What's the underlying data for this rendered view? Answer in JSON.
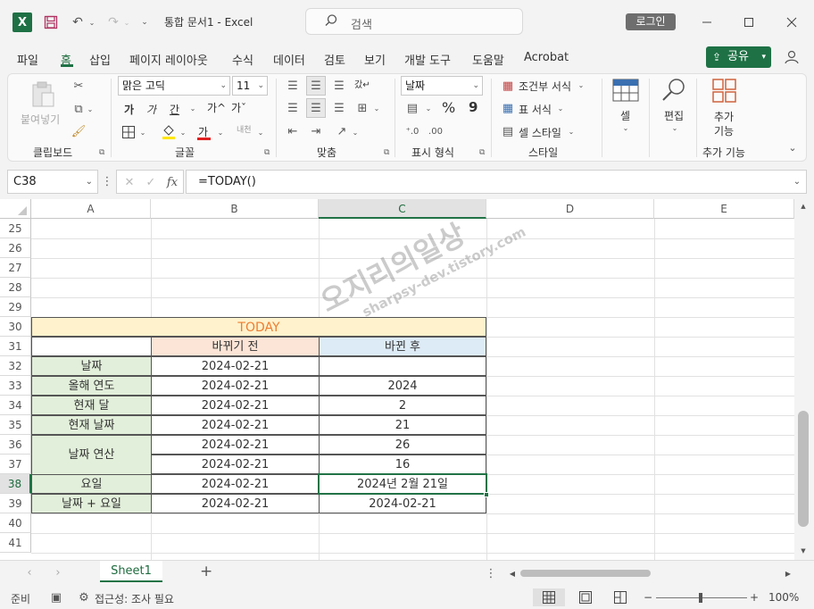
{
  "titlebar": {
    "app_title": "통합 문서1  -  Excel",
    "search_placeholder": "검색",
    "login_label": "로그인"
  },
  "menu": {
    "tabs": [
      "파일",
      "홈",
      "삽입",
      "페이지 레이아웃",
      "수식",
      "데이터",
      "검토",
      "보기",
      "개발 도구",
      "도움말",
      "Acrobat"
    ],
    "active_tab": "홈",
    "share_label": "공유"
  },
  "ribbon": {
    "clipboard": {
      "paste_label": "붙여넣기",
      "group_label": "클립보드"
    },
    "font": {
      "font_name": "맑은 고딕",
      "font_size": "11",
      "bold": "가",
      "italic": "가",
      "underline": "간",
      "grow": "가^",
      "shrink": "가ˇ",
      "color_char": "가",
      "phonetic": "내천",
      "group_label": "글꼴"
    },
    "alignment": {
      "wrap_icon": "갔↵",
      "group_label": "맞춤"
    },
    "number": {
      "format": "날짜",
      "percent": "%",
      "comma": "9",
      "group_label": "표시 형식"
    },
    "styles": {
      "conditional": "조건부 서식",
      "table": "표 서식",
      "cell_styles": "셀 스타일",
      "group_label": "스타일"
    },
    "cells": {
      "label": "셀"
    },
    "editing": {
      "label": "편집"
    },
    "addins": {
      "label_line1": "추가",
      "label_line2": "기능",
      "group_label": "추가 기능"
    }
  },
  "formula_bar": {
    "name_box": "C38",
    "formula": "=TODAY()"
  },
  "grid": {
    "columns": [
      "A",
      "B",
      "C",
      "D",
      "E"
    ],
    "selected_column": "C",
    "rows": [
      "25",
      "26",
      "27",
      "28",
      "29",
      "30",
      "31",
      "32",
      "33",
      "34",
      "35",
      "36",
      "37",
      "38",
      "39",
      "40",
      "41"
    ],
    "selected_row": "38",
    "table_title": "TODAY",
    "header_before": "바뀌기 전",
    "header_after": "바뀐 후",
    "labels": {
      "r32": "날짜",
      "r33": "올해 연도",
      "r34": "현재 달",
      "r35": "현재 날짜",
      "r36_37": "날짜 연산",
      "r38": "요일",
      "r39": "날짜 + 요일"
    },
    "before_values": {
      "r32": "2024-02-21",
      "r33": "2024-02-21",
      "r34": "2024-02-21",
      "r35": "2024-02-21",
      "r36": "2024-02-21",
      "r37": "2024-02-21",
      "r38": "2024-02-21",
      "r39": "2024-02-21"
    },
    "after_values": {
      "r33": "2024",
      "r34": "2",
      "r35": "21",
      "r36": "26",
      "r37": "16",
      "r38": "2024년 2월 21일",
      "r39": "2024-02-21"
    },
    "colors": {
      "title_fill": "#fff2cc",
      "title_text": "#ed7d31",
      "before_header_fill": "#fce4d6",
      "after_header_fill": "#ddebf7",
      "label_fill": "#e2efda",
      "accent": "#217346"
    }
  },
  "watermark": {
    "main": "오지리의일상",
    "sub": "sharpsy-dev.tistory.com"
  },
  "sheets": {
    "tabs": [
      "Sheet1"
    ],
    "add_label": "+"
  },
  "status": {
    "ready": "준비",
    "accessibility": "접근성: 조사 필요",
    "zoom_minus": "−",
    "zoom_plus": "+",
    "zoom": "100%"
  }
}
